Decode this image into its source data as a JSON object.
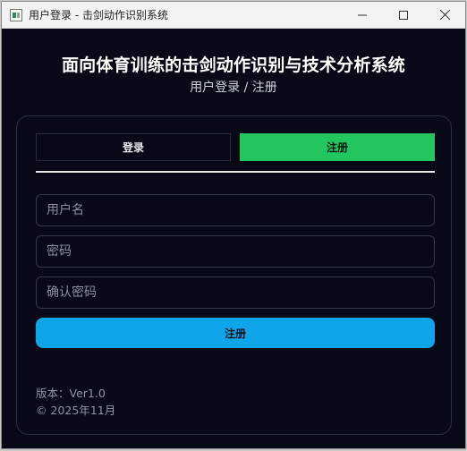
{
  "window": {
    "title": "用户登录 - 击剑动作识别系统",
    "minimize_glyph": "—",
    "maximize_glyph": "☐",
    "close_glyph": "✕"
  },
  "header": {
    "title": "面向体育训练的击剑动作识别与技术分析系统",
    "subtitle": "用户登录 / 注册"
  },
  "tabs": {
    "login_label": "登录",
    "register_label": "注册",
    "active": "register"
  },
  "form": {
    "username_placeholder": "用户名",
    "password_placeholder": "密码",
    "confirm_placeholder": "确认密码",
    "submit_label": "注册"
  },
  "footer": {
    "version": "版本：Ver1.0",
    "copyright": "© 2025年11月"
  },
  "colors": {
    "background": "#070a16",
    "accent_green": "#22c55e",
    "accent_blue": "#0ea5e9"
  }
}
